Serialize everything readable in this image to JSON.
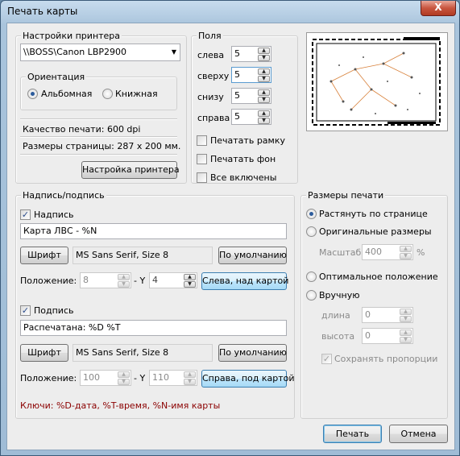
{
  "window": {
    "title": "Печать карты",
    "close_glyph": "X"
  },
  "printer": {
    "group_title": "Настройки принтера",
    "selected": "\\\\BOSS\\Canon LBP2900",
    "orientation_title": "Ориентация",
    "landscape": "Альбомная",
    "portrait": "Книжная",
    "quality": "Качество печати: 600 dpi",
    "page_size": "Размеры страницы: 287 x 200 мм.",
    "setup_button": "Настройка принтера"
  },
  "margins": {
    "group_title": "Поля",
    "left_label": "слева",
    "left_value": "5",
    "top_label": "сверху",
    "top_value": "5",
    "bottom_label": "снизу",
    "bottom_value": "5",
    "right_label": "справа",
    "right_value": "5",
    "print_frame": "Печатать рамку",
    "print_background": "Печатать фон",
    "all_enabled": "Все включены"
  },
  "caption": {
    "group_title": "Надпись/подпись",
    "header_check": "Надпись",
    "header_text": "Карта ЛВС - %N",
    "font_button": "Шрифт",
    "header_font": "MS Sans Serif, Size 8",
    "default_button": "По умолчанию",
    "position_label": "Положение: X",
    "y_label": "- Y",
    "header_x": "8",
    "header_y": "4",
    "header_pos_button": "Слева, над картой",
    "footer_check": "Подпись",
    "footer_text": "Распечатана: %D %T",
    "footer_font": "MS Sans Serif, Size 8",
    "footer_x": "100",
    "footer_y": "110",
    "footer_pos_button": "Справа, под картой",
    "keys": "Ключи: %D-дата, %T-время, %N-имя карты"
  },
  "print_size": {
    "group_title": "Размеры печати",
    "fit_page": "Растянуть по странице",
    "original": "Оригинальные размеры",
    "scale_label": "Масштаб",
    "scale_value": "400",
    "percent": "%",
    "optimal": "Оптимальное положение",
    "manual": "Вручную",
    "length_label": "длина",
    "length_value": "0",
    "height_label": "высота",
    "height_value": "0",
    "keep_proportions": "Сохранять пропорции"
  },
  "buttons": {
    "print": "Печать",
    "cancel": "Отмена"
  },
  "icons": {
    "checkbox_mark": "✓",
    "spin_up": "▲",
    "spin_down": "▼",
    "dropdown": "▼"
  }
}
